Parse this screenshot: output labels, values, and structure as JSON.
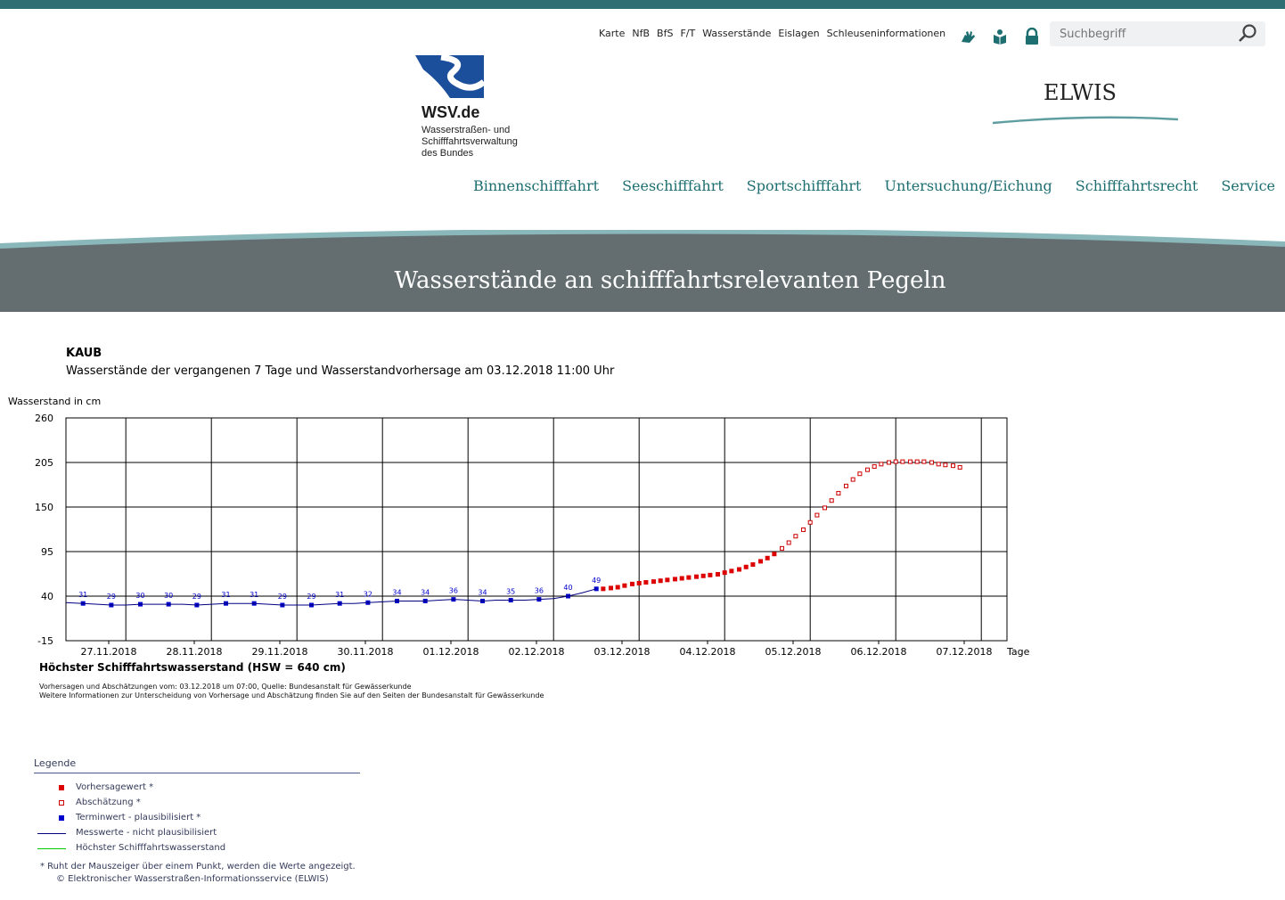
{
  "header": {
    "service_links": [
      "Karte",
      "NfB",
      "BfS",
      "F/T",
      "Wasserstände",
      "Eislagen",
      "Schleuseninformationen"
    ],
    "tool_icons": [
      "sign-language-icon",
      "easy-read-icon",
      "lock-icon"
    ],
    "search_placeholder": "Suchbegriff",
    "logo_name": "WSV.de",
    "logo_sub": [
      "Wasserstraßen- und",
      "Schifffahrtsverwaltung",
      "des Bundes"
    ],
    "site_title": "ELWIS",
    "main_nav": [
      "Binnenschifffahrt",
      "Seeschifffahrt",
      "Sportschifffahrt",
      "Untersuchung/Eichung",
      "Schifffahrtsrecht",
      "Service"
    ],
    "banner_title": "Wasserstände an schifffahrtsrelevanten Pegeln"
  },
  "page": {
    "station": "KAUB",
    "subtitle": "Wasserstände der vergangenen 7 Tage und Wasserstandvorhersage am 03.12.2018 11:00 Uhr",
    "hsw": "Höchster Schifffahrtswasserstand (HSW = 640 cm)",
    "notes": [
      "Vorhersagen und Abschätzungen vom: 03.12.2018 um 07:00, Quelle: Bundesanstalt für Gewässerkunde",
      "Weitere Informationen zur Unterscheidung von Vorhersage und Abschätzung finden Sie auf den Seiten der Bundesanstalt für Gewässerkunde"
    ]
  },
  "legend": {
    "title": "Legende",
    "items": [
      {
        "label": "Vorhersagewert *",
        "symbol": "filled-square",
        "color": "#dd0000"
      },
      {
        "label": "Abschätzung *",
        "symbol": "open-square",
        "color": "#cc0000"
      },
      {
        "label": "Terminwert - plausibilisiert *",
        "symbol": "filled-square",
        "color": "#0000cc"
      },
      {
        "label": "Messwerte - nicht plausibilisiert",
        "symbol": "line",
        "color": "#000080"
      },
      {
        "label": "Höchster Schifffahrtswasserstand",
        "symbol": "line",
        "color": "#00cc00"
      }
    ],
    "footnote": "* Ruht der Mauszeiger über einem Punkt, werden die Werte angezeigt.",
    "copyright": "© Elektronischer Wasserstraßen-Informationsservice (ELWIS)"
  },
  "colors": {
    "accent": "#1d6e71",
    "banner": "#646e70",
    "measured": "#000080",
    "termin": "#0000cc",
    "forecast": "#dd0000",
    "estimate": "#cc0000"
  },
  "chart_data": {
    "type": "line",
    "ylabel": "Wasserstand in cm",
    "xlabel": "Tage",
    "ylim": [
      -15,
      260
    ],
    "yticks": [
      -15,
      40,
      95,
      150,
      205,
      260
    ],
    "x_days": [
      "27.11.2018",
      "28.11.2018",
      "29.11.2018",
      "30.11.2018",
      "01.12.2018",
      "02.12.2018",
      "03.12.2018",
      "04.12.2018",
      "05.12.2018",
      "06.12.2018",
      "07.12.2018"
    ],
    "x_range_days": [
      -0.2,
      10.8
    ],
    "grid": true,
    "series": [
      {
        "name": "Terminwert - plausibilisiert",
        "style": "filled-square",
        "x": [
          0.0,
          0.33,
          0.67,
          1.0,
          1.33,
          1.67,
          2.0,
          2.33,
          2.67,
          3.0,
          3.33,
          3.67,
          4.0,
          4.33,
          4.67,
          5.0,
          5.33,
          5.67,
          6.0
        ],
        "values": [
          31,
          29,
          30,
          30,
          29,
          31,
          31,
          29,
          29,
          31,
          32,
          34,
          34,
          36,
          34,
          35,
          36,
          40,
          49
        ]
      },
      {
        "name": "Messwerte - nicht plausibilisiert",
        "style": "line",
        "x": [
          -0.2,
          0.0,
          0.17,
          0.33,
          0.5,
          0.67,
          0.83,
          1.0,
          1.17,
          1.33,
          1.5,
          1.67,
          1.83,
          2.0,
          2.17,
          2.33,
          2.5,
          2.67,
          2.83,
          3.0,
          3.17,
          3.33,
          3.5,
          3.67,
          3.83,
          4.0,
          4.17,
          4.33,
          4.5,
          4.67,
          4.83,
          5.0,
          5.17,
          5.33,
          5.5,
          5.67,
          5.83,
          6.0
        ],
        "values": [
          32,
          31,
          30,
          29,
          29,
          30,
          30,
          30,
          30,
          29,
          30,
          31,
          31,
          31,
          30,
          29,
          29,
          29,
          30,
          31,
          31,
          32,
          33,
          34,
          34,
          34,
          35,
          36,
          35,
          34,
          35,
          35,
          35,
          36,
          37,
          40,
          44,
          49
        ]
      },
      {
        "name": "Vorhersagewert",
        "style": "filled-square",
        "x": [
          6.08,
          6.17,
          6.25,
          6.33,
          6.42,
          6.5,
          6.58,
          6.67,
          6.75,
          6.83,
          6.92,
          7.0,
          7.08,
          7.17,
          7.25,
          7.33,
          7.42,
          7.5,
          7.58,
          7.67,
          7.75,
          7.83,
          7.92,
          8.0,
          8.08
        ],
        "values": [
          49,
          50,
          51,
          53,
          55,
          56,
          57,
          58,
          59,
          60,
          61,
          62,
          63,
          64,
          65,
          66,
          67,
          69,
          71,
          73,
          76,
          79,
          83,
          87,
          92
        ]
      },
      {
        "name": "Abschätzung",
        "style": "open-square",
        "x": [
          8.17,
          8.25,
          8.33,
          8.42,
          8.5,
          8.58,
          8.67,
          8.75,
          8.83,
          8.92,
          9.0,
          9.08,
          9.17,
          9.25,
          9.33,
          9.42,
          9.5,
          9.58,
          9.67,
          9.75,
          9.83,
          9.92,
          10.0,
          10.08,
          10.17,
          10.25
        ],
        "values": [
          99,
          106,
          114,
          122,
          131,
          140,
          149,
          158,
          167,
          176,
          184,
          191,
          196,
          200,
          203,
          205,
          206,
          206,
          206,
          206,
          206,
          205,
          203,
          202,
          201,
          199
        ]
      }
    ],
    "data_labels": {
      "x": [
        0.0,
        0.33,
        0.67,
        1.0,
        1.33,
        1.67,
        2.0,
        2.33,
        2.67,
        3.0,
        3.33,
        3.67,
        4.0,
        4.33,
        4.67,
        5.0,
        5.33,
        5.67,
        6.0
      ],
      "values": [
        31,
        29,
        30,
        30,
        29,
        31,
        31,
        29,
        29,
        31,
        32,
        34,
        34,
        36,
        34,
        35,
        36,
        40,
        49
      ]
    },
    "hsw": 640
  }
}
